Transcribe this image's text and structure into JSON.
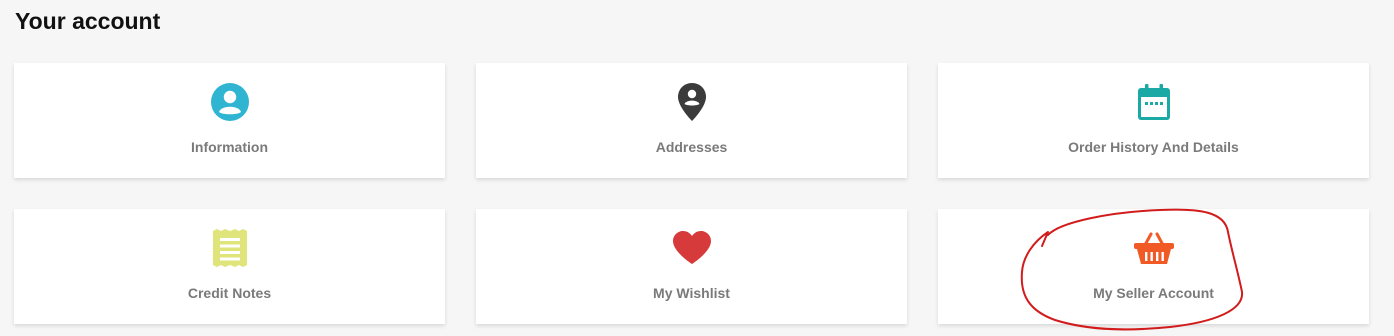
{
  "page": {
    "title": "Your account"
  },
  "cards": [
    {
      "label": "Information",
      "icon": "account-circle-icon",
      "color": "#2fb5d2"
    },
    {
      "label": "Addresses",
      "icon": "location-pin-icon",
      "color": "#3b3b3b"
    },
    {
      "label": "Order History And Details",
      "icon": "calendar-icon",
      "color": "#1aa9a4"
    },
    {
      "label": "Credit Notes",
      "icon": "receipt-icon",
      "color": "#dfe57a"
    },
    {
      "label": "My Wishlist",
      "icon": "heart-icon",
      "color": "#d63a3a"
    },
    {
      "label": "My Seller Account",
      "icon": "shopping-basket-icon",
      "color": "#f15a24"
    }
  ],
  "annotation": {
    "type": "hand-drawn-circle",
    "target": "My Seller Account",
    "color": "#d21c1c"
  }
}
